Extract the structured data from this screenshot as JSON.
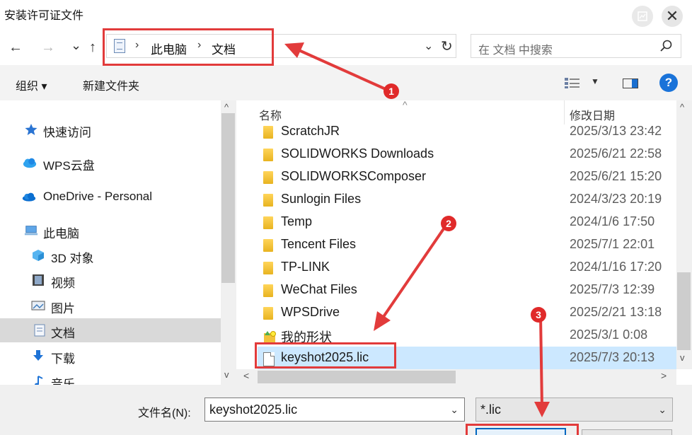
{
  "window": {
    "title": "安装许可证文件",
    "close_glyph": "✕"
  },
  "address": {
    "crumbs": [
      "此电脑",
      "文档"
    ],
    "separator": "›",
    "dropdown_glyph": "⌄",
    "refresh_glyph": "↻"
  },
  "nav": {
    "back": "←",
    "forward": "→",
    "recent": "⌄",
    "up": "↑"
  },
  "search": {
    "placeholder": "在 文档 中搜索"
  },
  "toolbar": {
    "organize": "组织 ▾",
    "new_folder": "新建文件夹",
    "view_dropdown": "▼",
    "help": "?"
  },
  "sidebar": {
    "items": [
      {
        "label": "快速访问",
        "icon": "star-icon"
      },
      {
        "label": "WPS云盘",
        "icon": "cloud-icon"
      },
      {
        "label": "OneDrive - Personal",
        "icon": "onedrive-icon"
      },
      {
        "label": "此电脑",
        "icon": "computer-icon"
      },
      {
        "label": "3D 对象",
        "icon": "cube-icon"
      },
      {
        "label": "视频",
        "icon": "video-icon"
      },
      {
        "label": "图片",
        "icon": "picture-icon"
      },
      {
        "label": "文档",
        "icon": "document-icon"
      },
      {
        "label": "下载",
        "icon": "download-icon"
      },
      {
        "label": "音乐",
        "icon": "music-icon"
      }
    ]
  },
  "columns": {
    "name": "名称",
    "date": "修改日期",
    "sort_caret": "^"
  },
  "files": [
    {
      "name": "ScratchJR",
      "date": "2025/3/13 23:42",
      "type": "folder"
    },
    {
      "name": "SOLIDWORKS Downloads",
      "date": "2025/6/21 22:58",
      "type": "folder"
    },
    {
      "name": "SOLIDWORKSComposer",
      "date": "2025/6/21 15:20",
      "type": "folder"
    },
    {
      "name": "Sunlogin Files",
      "date": "2024/3/23 20:19",
      "type": "folder"
    },
    {
      "name": "Temp",
      "date": "2024/1/6 17:50",
      "type": "folder"
    },
    {
      "name": "Tencent Files",
      "date": "2025/7/1 22:01",
      "type": "folder"
    },
    {
      "name": "TP-LINK",
      "date": "2024/1/16 17:20",
      "type": "folder"
    },
    {
      "name": "WeChat Files",
      "date": "2025/7/3 12:39",
      "type": "folder"
    },
    {
      "name": "WPSDrive",
      "date": "2025/2/21 13:18",
      "type": "folder"
    },
    {
      "name": "我的形状",
      "date": "2025/3/1 0:08",
      "type": "shapes"
    },
    {
      "name": "keyshot2025.lic",
      "date": "2025/7/3 20:13",
      "type": "file"
    }
  ],
  "selected_file_index": 10,
  "bottom": {
    "filename_label": "文件名(N):",
    "filename_value": "keyshot2025.lic",
    "filetype_value": "*.lic",
    "dropdown_glyph": "⌄"
  },
  "scroll": {
    "up": "^",
    "down": "v",
    "left": "<",
    "right": ">"
  },
  "annotations": {
    "badges": [
      "1",
      "2",
      "3"
    ],
    "color": "#e23b3b"
  },
  "colors": {
    "selection": "#cce8ff",
    "sidebar_selected": "#d9d9d9",
    "accent": "#0067c0",
    "folder": "#f2c23a"
  }
}
